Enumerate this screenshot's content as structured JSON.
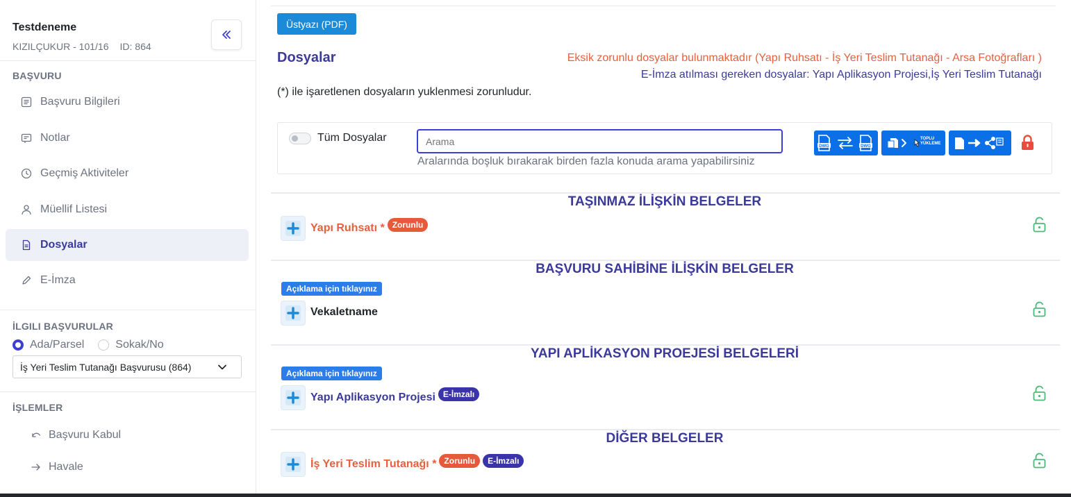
{
  "sidebar": {
    "project_title": "Testdeneme",
    "project_location": "KIZILÇUKUR - 101/16",
    "project_id": "ID: 864",
    "collapse_icon": "double-chevron-left-icon",
    "section_basvuru": "BAŞVURU",
    "nav": [
      {
        "label": "Başvuru Bilgileri",
        "icon": "list-icon"
      },
      {
        "label": "Notlar",
        "icon": "note-icon"
      },
      {
        "label": "Geçmiş Aktiviteler",
        "icon": "clock-icon"
      },
      {
        "label": "Müellif Listesi",
        "icon": "user-icon"
      },
      {
        "label": "Dosyalar",
        "icon": "file-icon",
        "active": true
      },
      {
        "label": "E-İmza",
        "icon": "pen-icon"
      }
    ],
    "section_related": "İLGILI BAŞVURULAR",
    "radio_options": [
      {
        "label": "Ada/Parsel",
        "checked": true
      },
      {
        "label": "Sokak/No",
        "checked": false
      }
    ],
    "related_select_value": "İş Yeri Teslim Tutanağı Başvurusu (864)",
    "section_operations": "İŞLEMLER",
    "operations": [
      {
        "label": "Başvuru Kabul",
        "icon": "undo-icon"
      },
      {
        "label": "Havale",
        "icon": "arrow-right-icon"
      }
    ]
  },
  "main": {
    "pdf_button": "Üstyazı (PDF)",
    "title": "Dosyalar",
    "warning_missing": "Eksik zorunlu dosyalar bulunmaktadır (Yapı Ruhsatı - İş Yeri Teslim Tutanağı - Arsa Fotoğrafları )",
    "warning_sign": "E-İmza atılması gereken dosyalar: Yapı Aplikasyon Projesi,İş Yeri Teslim Tutanağı",
    "required_note": "(*) ile işaretlenen dosyaların yuklenmesi zorunludur.",
    "filter": {
      "toggle_label": "Tüm Dosyalar",
      "toggle_on": false,
      "search_placeholder": "Arama",
      "search_hint": "Aralarında boşluk bırakarak birden fazla konuda arama yapabilirsiniz",
      "tools": [
        {
          "icon": "dwg-convert-icon"
        },
        {
          "icon": "bulk-upload-icon",
          "label": "TOPLU YÜKLEME"
        },
        {
          "icon": "file-share-icon"
        }
      ],
      "lock_icon": "lock-closed-icon",
      "lock_color": "#e74c3c"
    },
    "categories": [
      {
        "title": "TAŞINMAZ İLİŞKİN BELGELER",
        "docs": [
          {
            "name": "Yapı Ruhsatı",
            "required_mark": "*",
            "badges": [
              "Zorunlu"
            ]
          }
        ]
      },
      {
        "title": "BAŞVURU SAHİBİNE İLİŞKİN BELGELER",
        "info_tag": "Açıklama için tıklayınız",
        "docs": [
          {
            "name": "Vekaletname",
            "badges": []
          }
        ]
      },
      {
        "title": "YAPI APLİKASYON PROEJESİ BELGELERİ",
        "info_tag": "Açıklama için tıklayınız",
        "docs": [
          {
            "name": "Yapı Aplikasyon Projesi",
            "badges": [
              "E-İmzalı"
            ]
          }
        ]
      },
      {
        "title": "DİĞER BELGELER",
        "docs": [
          {
            "name": "İş Yeri Teslim Tutanağı",
            "required_mark": "*",
            "badges": [
              "Zorunlu",
              "E-İmzalı"
            ]
          }
        ]
      }
    ],
    "doc_lock_icon": "lock-open-icon",
    "colors": {
      "accent": "#3b3a9b",
      "required": "#e5613d",
      "primary_button": "#0b6fe8",
      "badge_required": "#e65a3c",
      "badge_signed": "#3a34a8",
      "lock_open": "#4cb97a"
    }
  }
}
